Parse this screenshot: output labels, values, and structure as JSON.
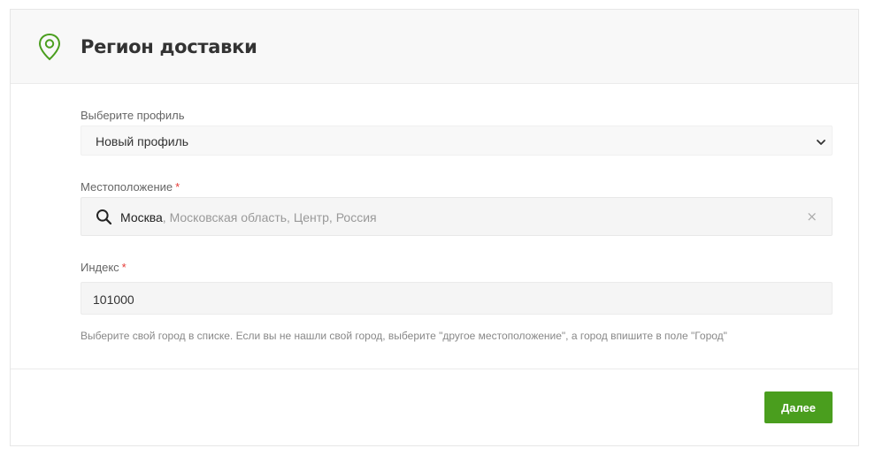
{
  "header": {
    "icon": "location-pin-icon",
    "title": "Регион доставки"
  },
  "profile": {
    "label": "Выберите профиль",
    "selected": "Новый профиль"
  },
  "location": {
    "label": "Местоположение",
    "required_mark": "*",
    "city": "Москва",
    "rest": ", Московская область, Центр, Россия",
    "clear_glyph": "×"
  },
  "index": {
    "label": "Индекс",
    "required_mark": "*",
    "value": "101000"
  },
  "hint": "Выберите свой город в списке. Если вы не нашли свой город, выберите \"другое местоположение\", а город впишите в поле \"Город\"",
  "footer": {
    "next_label": "Далее"
  },
  "colors": {
    "accent": "#4a9e1e",
    "required": "#e53935"
  }
}
